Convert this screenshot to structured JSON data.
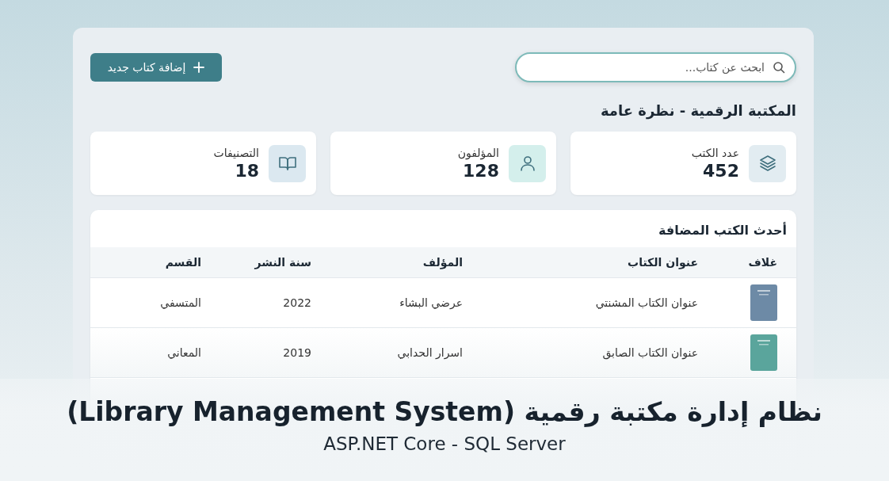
{
  "search": {
    "placeholder": "ابحث عن كتاب..."
  },
  "add_button": {
    "label": "إضافة كتاب جديد"
  },
  "overview_title": "المكتبة الرقمية - نظرة عامة",
  "stats": [
    {
      "kind": "books",
      "label": "عدد الكتب",
      "value": "452",
      "color": "#e2ecf1"
    },
    {
      "kind": "authors",
      "label": "المؤلفون",
      "value": "128",
      "color": "#d4efec"
    },
    {
      "kind": "categories",
      "label": "التصنيفات",
      "value": "18",
      "color": "#dbe8f0"
    }
  ],
  "recent_books": {
    "title": "أحدث الكتب المضافة",
    "columns": [
      "غلاف",
      "عنوان الكتاب",
      "المؤلف",
      "سنة النشر",
      "القسم"
    ],
    "rows": [
      {
        "color": "#6d8aa6",
        "title": "عنوان الكتاب المشنتي",
        "author": "عرضي البشاء",
        "year": "2022",
        "category": "المتسفي"
      },
      {
        "color": "#5aa59c",
        "title": "عنوان الكتاب الصابق",
        "author": "اسرار الحدابي",
        "year": "2019",
        "category": "المعاني"
      }
    ]
  },
  "caption": {
    "title": "نظام إدارة مكتبة رقمية (Library Management System)",
    "subtitle": "ASP.NET Core - SQL Server"
  }
}
